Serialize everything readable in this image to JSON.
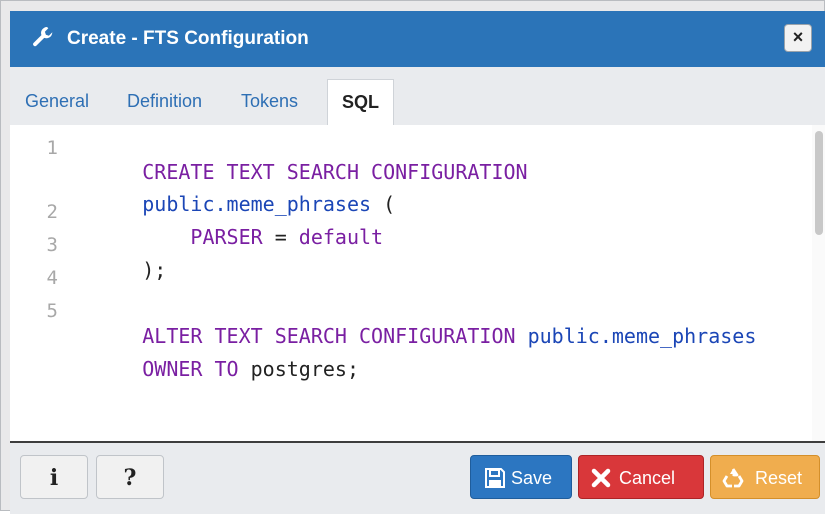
{
  "dialog": {
    "title": "Create - FTS Configuration",
    "close_glyph": "×",
    "icon": "wrench-icon"
  },
  "tabs": [
    {
      "label": "General"
    },
    {
      "label": "Definition"
    },
    {
      "label": "Tokens"
    },
    {
      "label": "SQL",
      "active": true
    }
  ],
  "editor": {
    "language": "sql",
    "line_numbers": [
      "1",
      "2",
      "3",
      "4",
      "5"
    ],
    "lines": [
      {
        "n": "1",
        "text": "CREATE TEXT SEARCH CONFIGURATION"
      },
      {
        "n": "",
        "text": "public.meme_phrases ("
      },
      {
        "n": "2",
        "text": "    PARSER = default"
      },
      {
        "n": "3",
        "text": ");"
      },
      {
        "n": "4",
        "text": ""
      },
      {
        "n": "5",
        "text": "ALTER TEXT SEARCH CONFIGURATION public.meme_phrases"
      },
      {
        "n": "",
        "text": "OWNER TO postgres;"
      }
    ]
  },
  "footer": {
    "info_glyph": "i",
    "help_glyph": "?",
    "save_label": "Save",
    "cancel_label": "Cancel",
    "reset_label": "Reset"
  },
  "colors": {
    "titlebar": "#2b74b8",
    "keyword": "#7a1fa2",
    "identifier": "#1b46b6",
    "save": "#2c76c1",
    "cancel": "#d9373a",
    "reset": "#f0ad4e"
  }
}
